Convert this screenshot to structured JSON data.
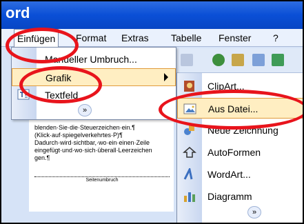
{
  "window": {
    "title": "ord"
  },
  "menubar": {
    "items": [
      "Einfügen",
      "Format",
      "Extras",
      "Tabelle",
      "Fenster",
      "?"
    ]
  },
  "dropdown": {
    "items": [
      {
        "label": "Manueller Umbruch...",
        "icon": "page-break-icon"
      },
      {
        "label": "Grafik",
        "icon": "picture-icon",
        "has_submenu": true
      },
      {
        "label": "Textfeld",
        "icon": "textbox-icon"
      }
    ],
    "expand": "»"
  },
  "submenu": {
    "items": [
      {
        "label": "ClipArt...",
        "icon": "clipart-icon"
      },
      {
        "label": "Aus Datei...",
        "icon": "picture-from-file-icon"
      },
      {
        "label": "Neue Zeichnung",
        "icon": "drawing-icon"
      },
      {
        "label": "AutoFormen",
        "icon": "autoshapes-icon"
      },
      {
        "label": "WordArt...",
        "icon": "wordart-icon"
      },
      {
        "label": "Diagramm",
        "icon": "diagram-icon"
      }
    ],
    "expand": "»"
  },
  "document": {
    "lines": [
      "blenden·Sie·die·Steuerzeichen·ein.¶",
      "(Klick·auf·spiegelverkehrtes·P)¶",
      "Dadurch·wird·sichtbar,·wo·ein·einen·Zeile",
      "eingefügt·und·wo·sich·überall·Leerzeichen",
      "gen.¶"
    ],
    "page_break": "Seitenumbruch"
  },
  "colors": {
    "highlight": "#e8141c",
    "selected": "#ffeec2",
    "title_bar": "#0a4fd6"
  }
}
